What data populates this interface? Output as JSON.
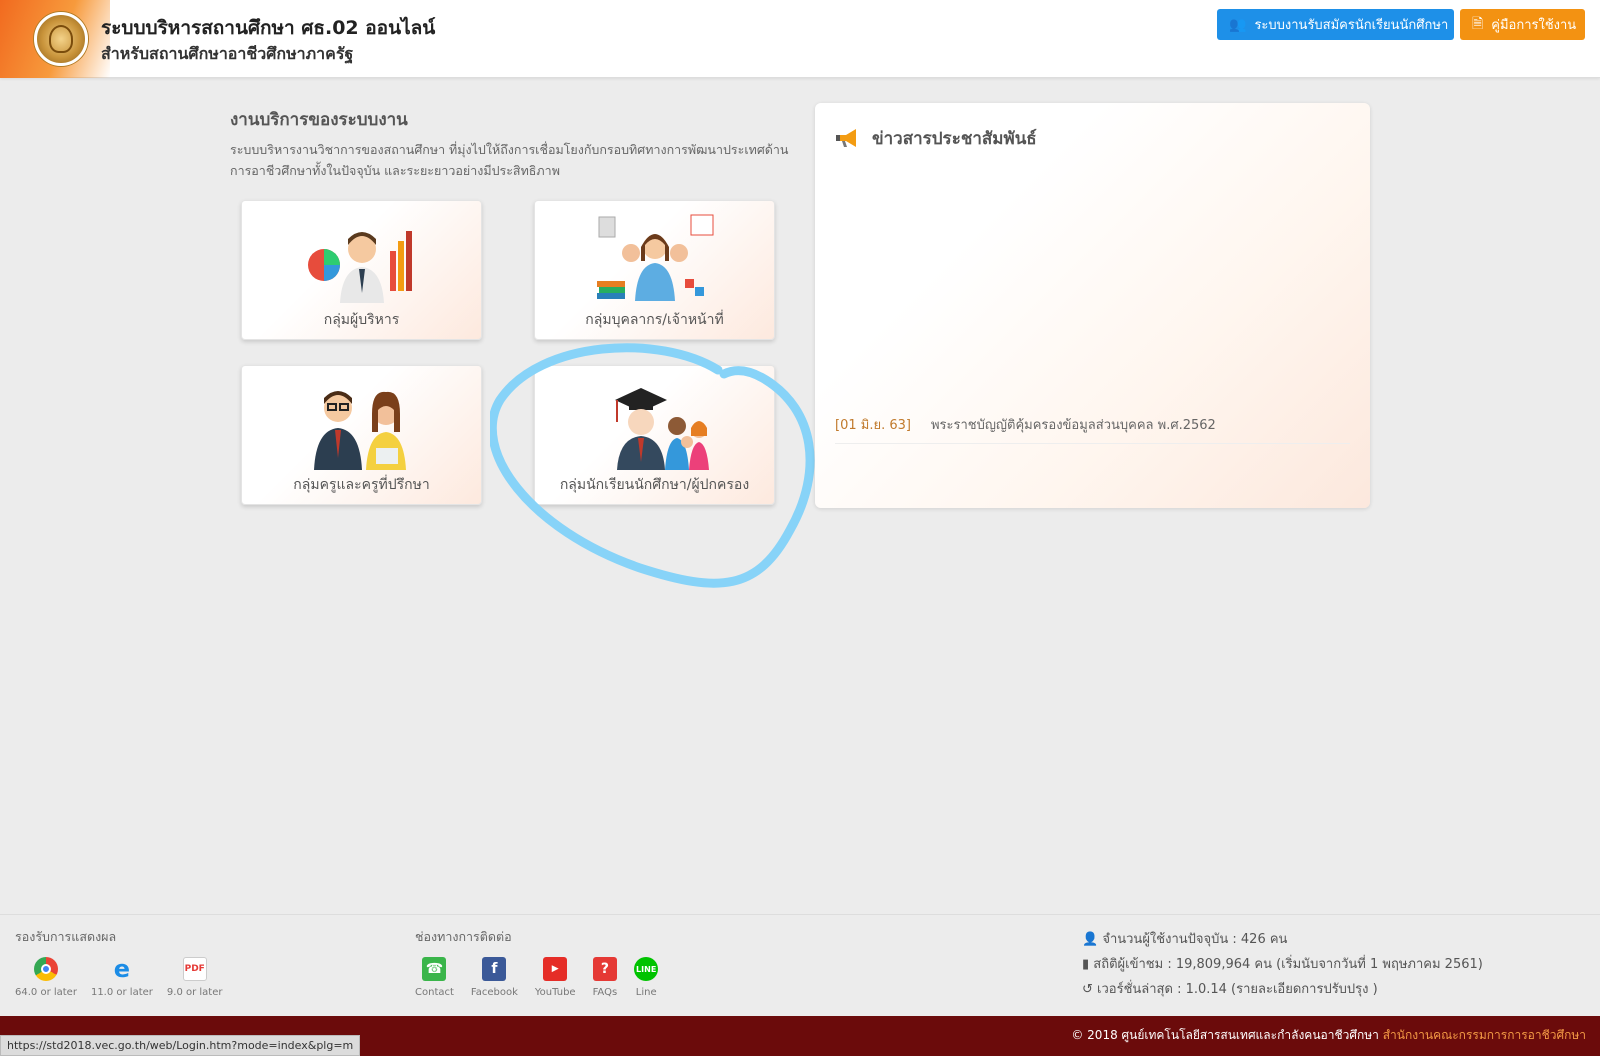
{
  "header": {
    "title": "ระบบบริหารสถานศึกษา ศธ.02 ออนไลน์",
    "subtitle": "สำหรับสถานศึกษาอาชีวศึกษาภาครัฐ",
    "buttons": {
      "admission": "ระบบงานรับสมัครนักเรียนนักศึกษา",
      "manual": "คู่มือการใช้งาน"
    },
    "colors": {
      "accent_blue": "#1e90e8",
      "accent_orange": "#f39212"
    }
  },
  "services": {
    "title": "งานบริการของระบบงาน",
    "description": "ระบบบริหารงานวิชาการของสถานศึกษา ที่มุ่งไปให้ถึงการเชื่อมโยงกับกรอบทิศทางการพัฒนาประเทศด้านการอาชีวศึกษาทั้งในปัจจุบัน และระยะยาวอย่างมีประสิทธิภาพ",
    "cards": [
      {
        "label": "กลุ่มผู้บริหาร"
      },
      {
        "label": "กลุ่มบุคลากร/เจ้าหน้าที่"
      },
      {
        "label": "กลุ่มครูและครูที่ปรึกษา"
      },
      {
        "label": "กลุ่มนักเรียนนักศึกษา/ผู้ปกครอง"
      }
    ]
  },
  "news": {
    "title": "ข่าวสารประชาสัมพันธ์",
    "items": [
      {
        "date": "[01 มิ.ย. 63]",
        "text": "พระราชบัญญัติคุ้มครองข้อมูลส่วนบุคคล พ.ศ.2562"
      }
    ]
  },
  "footer": {
    "support_title": "รองรับการแสดงผล",
    "browsers": [
      {
        "icon": "chrome-icon",
        "label": "64.0 or later"
      },
      {
        "icon": "ie-icon",
        "label": "11.0 or later"
      },
      {
        "icon": "pdf-icon",
        "label": "9.0 or later"
      }
    ],
    "contact_title": "ช่องทางการติดต่อ",
    "contacts": [
      {
        "icon": "phone-icon",
        "label": "Contact"
      },
      {
        "icon": "facebook-icon",
        "label": "Facebook"
      },
      {
        "icon": "youtube-icon",
        "label": "YouTube"
      },
      {
        "icon": "faq-icon",
        "label": "FAQs"
      },
      {
        "icon": "line-icon",
        "label": "Line"
      }
    ],
    "stats": {
      "users": "จำนวนผู้ใช้งานปัจจุบัน : 426 คน",
      "visits": "สถิติผู้เข้าชม : 19,809,964 คน (เริ่มนับจากวันที่ 1 พฤษภาคม 2561)",
      "version": "เวอร์ชั่นล่าสุด : 1.0.14 (รายละเอียดการปรับปรุง )"
    },
    "copyright": "© 2018 ศูนย์เทคโนโลยีสารสนเทศและกำลังคนอาชีวศึกษา",
    "copyright_link": "สำนักงานคณะกรรมการการอาชีวศึกษา"
  },
  "statusbar": {
    "url": "https://std2018.vec.go.th/web/Login.htm?mode=index&plg=m"
  }
}
